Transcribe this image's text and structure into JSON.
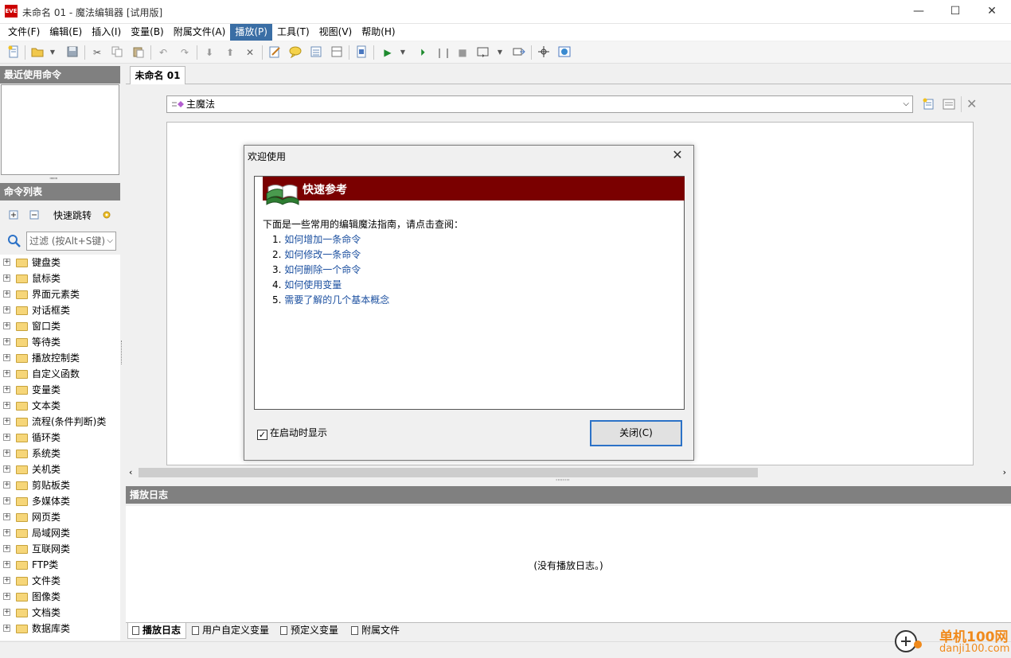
{
  "window": {
    "title": "未命名 01 - 魔法编辑器  [试用版]",
    "icon_text": "EVE",
    "minimize": "—",
    "maximize": "☐",
    "close": "✕"
  },
  "menu": [
    "文件(F)",
    "编辑(E)",
    "插入(I)",
    "变量(B)",
    "附属文件(A)",
    "播放(P)",
    "工具(T)",
    "视图(V)",
    "帮助(H)"
  ],
  "menu_active_index": 5,
  "left_panel": {
    "recent_header": "最近使用命令",
    "cmd_header": "命令列表",
    "quick_jump": "快速跳转",
    "filter_placeholder": "过滤 (按Alt+S键)",
    "categories": [
      "键盘类",
      "鼠标类",
      "界面元素类",
      "对话框类",
      "窗口类",
      "等待类",
      "播放控制类",
      "自定义函数",
      "变量类",
      "文本类",
      "流程(条件判断)类",
      "循环类",
      "系统类",
      "关机类",
      "剪贴板类",
      "多媒体类",
      "网页类",
      "局域网类",
      "互联网类",
      "FTP类",
      "文件类",
      "图像类",
      "文档类",
      "数据库类"
    ]
  },
  "document": {
    "tab": "未命名 01",
    "magic_select": "主魔法"
  },
  "log": {
    "header": "播放日志",
    "empty": "(没有播放日志。)"
  },
  "bottom_tabs": [
    "播放日志",
    "用户自定义变量",
    "预定义变量",
    "附属文件"
  ],
  "dialog": {
    "title": "欢迎使用",
    "banner": "快速参考",
    "intro": "下面是一些常用的编辑魔法指南，请点击查阅：",
    "links": [
      {
        "num": "1.",
        "text": "如何增加一条命令"
      },
      {
        "num": "2.",
        "text": "如何修改一条命令"
      },
      {
        "num": "3.",
        "text": "如何删除一个命令"
      },
      {
        "num": "4.",
        "text": "如何使用变量"
      },
      {
        "num": "5.",
        "text": "需要了解的几个基本概念"
      }
    ],
    "show_on_startup": "在启动时显示",
    "show_on_startup_checked": true,
    "close_button": "关闭(C)"
  },
  "watermark": {
    "name": "单机100网",
    "url": "danji100.com"
  },
  "colors": {
    "banner": "#7a0000",
    "link": "#1c50a0",
    "panel_header": "#808080",
    "menu_active": "#3a6ea5"
  }
}
